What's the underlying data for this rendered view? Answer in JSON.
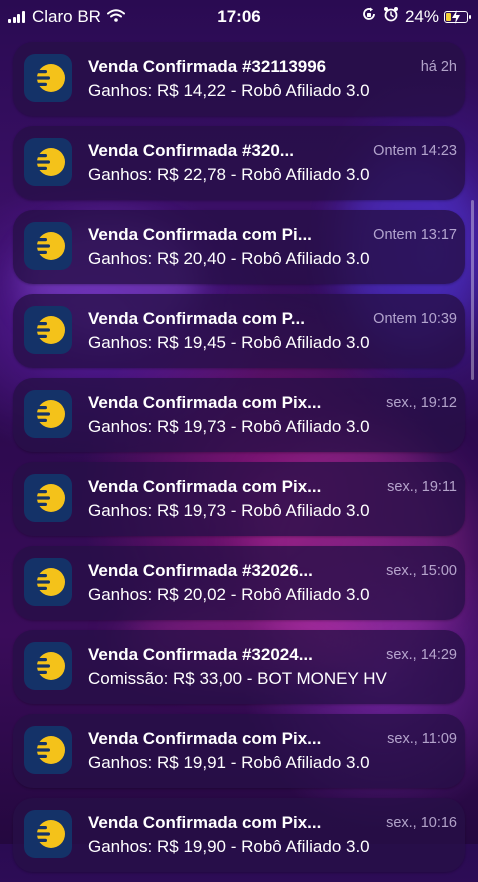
{
  "status_bar": {
    "carrier": "Claro BR",
    "time": "17:06",
    "battery_percent": "24%",
    "battery_level": 0.24,
    "battery_color": "#f4d23a",
    "icons": [
      "signal-icon",
      "wifi-icon",
      "orientation-lock-icon",
      "alarm-icon",
      "battery-icon",
      "charging-icon"
    ]
  },
  "app": {
    "icon": "app-logo-icon",
    "icon_bg_color": "#143268",
    "icon_accent_color": "#f4c21a"
  },
  "notifications": [
    {
      "title": "Venda Confirmada #32113996",
      "time": "há 2h",
      "body": "Ganhos: R$ 14,22 - Robô  Afiliado 3.0"
    },
    {
      "title": "Venda Confirmada #320...",
      "time": "Ontem 14:23",
      "body": "Ganhos: R$ 22,78 - Robô  Afiliado 3.0"
    },
    {
      "title": "Venda Confirmada com Pi...",
      "time": "Ontem 13:17",
      "body": "Ganhos: R$ 20,40 - Robô  Afiliado 3.0"
    },
    {
      "title": "Venda Confirmada com P...",
      "time": "Ontem 10:39",
      "body": "Ganhos: R$ 19,45 - Robô  Afiliado 3.0"
    },
    {
      "title": "Venda Confirmada com Pix...",
      "time": "sex., 19:12",
      "body": "Ganhos: R$ 19,73 - Robô  Afiliado 3.0"
    },
    {
      "title": "Venda Confirmada com Pix...",
      "time": "sex., 19:11",
      "body": "Ganhos: R$ 19,73 - Robô  Afiliado 3.0"
    },
    {
      "title": "Venda Confirmada #32026...",
      "time": "sex., 15:00",
      "body": "Ganhos: R$ 20,02 - Robô  Afiliado 3.0"
    },
    {
      "title": "Venda Confirmada #32024...",
      "time": "sex., 14:29",
      "body": "Comissão: R$ 33,00 - BOT MONEY HV"
    },
    {
      "title": "Venda Confirmada com Pix...",
      "time": "sex., 11:09",
      "body": "Ganhos: R$ 19,91 - Robô Afiliado 3.0"
    },
    {
      "title": "Venda Confirmada com Pix...",
      "time": "sex., 10:16",
      "body": "Ganhos: R$ 19,90 - Robô  Afiliado 3.0"
    }
  ]
}
